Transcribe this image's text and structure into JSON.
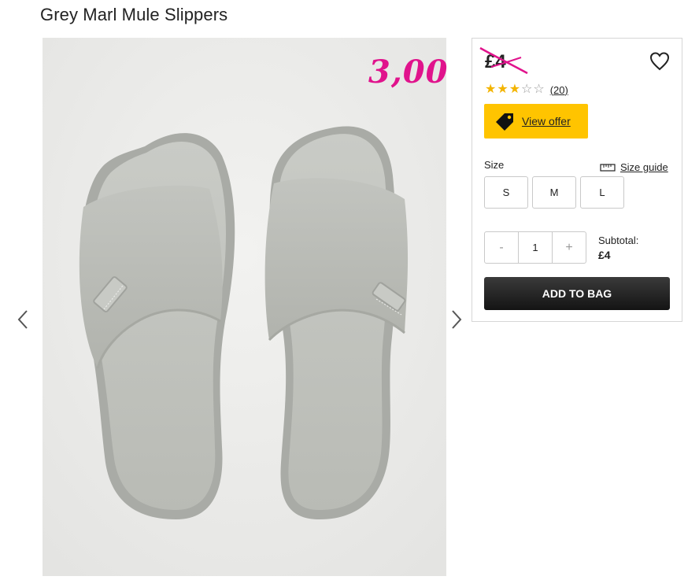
{
  "product": {
    "title": "Grey Marl Mule Slippers",
    "price": "£4",
    "handwritten_price": "3,00",
    "rating": 3,
    "rating_max": 5,
    "reviews": "(20)",
    "offer_label": "View offer",
    "size_label": "Size",
    "size_guide_label": "Size guide",
    "sizes": [
      "S",
      "M",
      "L"
    ],
    "qty_minus": "-",
    "qty_value": "1",
    "qty_plus": "+",
    "subtotal_label": "Subtotal:",
    "subtotal_value": "£4",
    "add_to_bag": "ADD TO BAG"
  },
  "colors": {
    "offer_bg": "#ffc400",
    "star": "#f3b400",
    "handwriting": "#e0138c",
    "button_dark": "#1e1e1e"
  },
  "icons": {
    "left": "chevron-left-icon",
    "right": "chevron-right-icon",
    "wishlist": "heart-icon",
    "offer": "tag-icon",
    "size_guide": "ruler-icon"
  }
}
